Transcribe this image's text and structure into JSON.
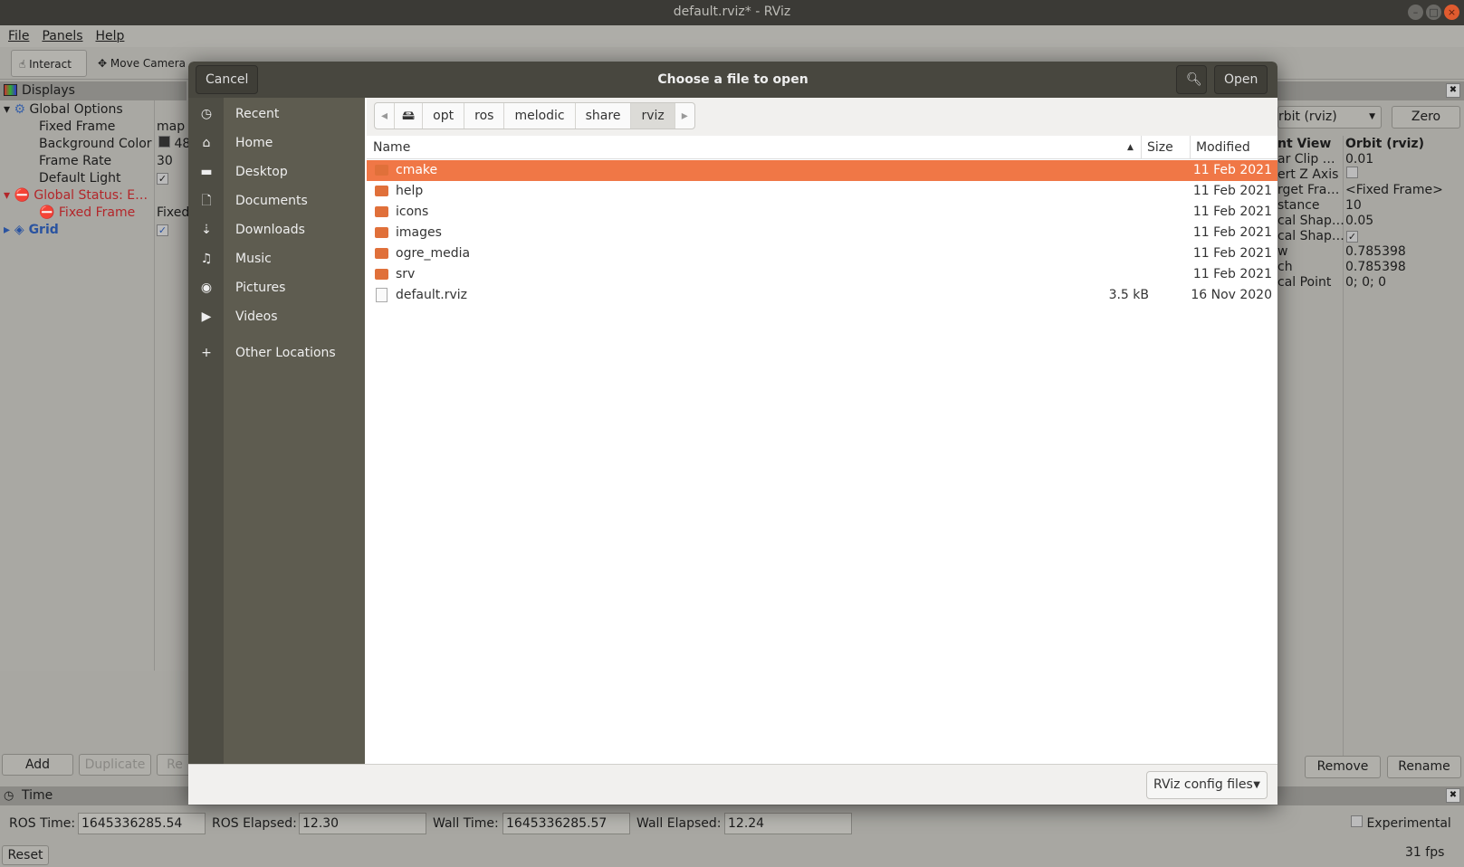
{
  "window": {
    "title": "default.rviz* - RViz"
  },
  "menu": [
    "File",
    "Panels",
    "Help"
  ],
  "toolbar": {
    "interact": "Interact",
    "move_camera": "Move Camera"
  },
  "displays": {
    "title": "Displays",
    "rows": [
      {
        "name": "Global Options",
        "value": ""
      },
      {
        "name": "Fixed Frame",
        "value": "map"
      },
      {
        "name": "Background Color",
        "value": "48"
      },
      {
        "name": "Frame Rate",
        "value": "30"
      },
      {
        "name": "Default Light",
        "value": "✓"
      },
      {
        "name": "Global Status: E…",
        "value": ""
      },
      {
        "name": "Fixed Frame",
        "value": "Fixed"
      },
      {
        "name": "Grid",
        "value": "✓"
      }
    ],
    "buttons": {
      "add": "Add",
      "duplicate": "Duplicate",
      "rename_partial": "Re"
    }
  },
  "views": {
    "type": "rbit (rviz)",
    "zero": "Zero",
    "rows": [
      {
        "name": "nt View",
        "value": "Orbit (rviz)"
      },
      {
        "name": "ar Clip …",
        "value": "0.01"
      },
      {
        "name": "ert Z Axis",
        "value": ""
      },
      {
        "name": "rget Fra…",
        "value": "<Fixed Frame>"
      },
      {
        "name": "stance",
        "value": "10"
      },
      {
        "name": "cal Shap…",
        "value": "0.05"
      },
      {
        "name": "cal Shap…",
        "value": "✓"
      },
      {
        "name": "w",
        "value": "0.785398"
      },
      {
        "name": "ch",
        "value": "0.785398"
      },
      {
        "name": "cal Point",
        "value": "0; 0; 0"
      }
    ],
    "remove": "Remove",
    "rename": "Rename"
  },
  "dialog": {
    "title": "Choose a file to open",
    "cancel": "Cancel",
    "open": "Open",
    "places": [
      {
        "icon": "clock-icon",
        "label": "Recent"
      },
      {
        "icon": "home-icon",
        "label": "Home"
      },
      {
        "icon": "folder-icon",
        "label": "Desktop"
      },
      {
        "icon": "document-icon",
        "label": "Documents"
      },
      {
        "icon": "download-icon",
        "label": "Downloads"
      },
      {
        "icon": "music-icon",
        "label": "Music"
      },
      {
        "icon": "camera-icon",
        "label": "Pictures"
      },
      {
        "icon": "video-icon",
        "label": "Videos"
      },
      {
        "icon": "plus-icon",
        "label": "Other Locations"
      }
    ],
    "path": [
      "opt",
      "ros",
      "melodic",
      "share",
      "rviz"
    ],
    "columns": {
      "name": "Name",
      "size": "Size",
      "modified": "Modified"
    },
    "files": [
      {
        "name": "cmake",
        "size": "",
        "modified": "11 Feb 2021",
        "type": "folder",
        "selected": true
      },
      {
        "name": "help",
        "size": "",
        "modified": "11 Feb 2021",
        "type": "folder"
      },
      {
        "name": "icons",
        "size": "",
        "modified": "11 Feb 2021",
        "type": "folder"
      },
      {
        "name": "images",
        "size": "",
        "modified": "11 Feb 2021",
        "type": "folder"
      },
      {
        "name": "ogre_media",
        "size": "",
        "modified": "11 Feb 2021",
        "type": "folder"
      },
      {
        "name": "srv",
        "size": "",
        "modified": "11 Feb 2021",
        "type": "folder"
      },
      {
        "name": "default.rviz",
        "size": "3.5 kB",
        "modified": "16 Nov 2020",
        "type": "file"
      }
    ],
    "filter": "RViz config files",
    "accent": "#f07746"
  },
  "time": {
    "title": "Time",
    "ros_time_label": "ROS Time:",
    "ros_time": "1645336285.54",
    "ros_elapsed_label": "ROS Elapsed:",
    "ros_elapsed": "12.30",
    "wall_time_label": "Wall Time:",
    "wall_time": "1645336285.57",
    "wall_elapsed_label": "Wall Elapsed:",
    "wall_elapsed": "12.24",
    "experimental": "Experimental",
    "reset": "Reset",
    "fps": "31 fps"
  }
}
